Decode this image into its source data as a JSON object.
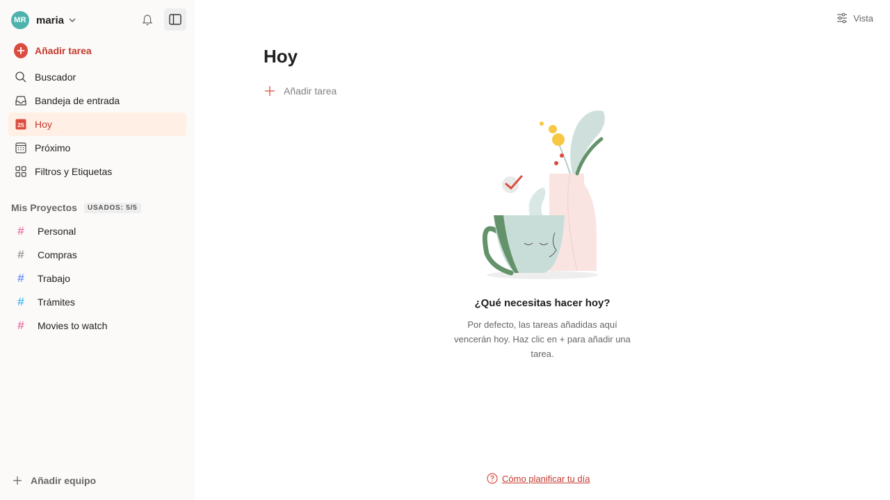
{
  "colors": {
    "accent": "#dc4c3e",
    "accent_text": "#c3392c",
    "avatar_bg": "#4eb3ac",
    "active_bg": "#ffefe5",
    "sidebar_bg": "#fcfaf8"
  },
  "user": {
    "initials": "MR",
    "name": "maria"
  },
  "sidebar": {
    "add_task_label": "Añadir tarea",
    "nav": [
      {
        "label": "Buscador",
        "icon": "search-icon"
      },
      {
        "label": "Bandeja de entrada",
        "icon": "inbox-icon"
      },
      {
        "label": "Hoy",
        "icon": "today-calendar-icon",
        "icon_text": "25",
        "active": true
      },
      {
        "label": "Próximo",
        "icon": "upcoming-calendar-icon"
      },
      {
        "label": "Filtros y Etiquetas",
        "icon": "filters-grid-icon"
      }
    ],
    "projects_title": "Mis Proyectos",
    "projects_usage": "USADOS: 5/5",
    "projects": [
      {
        "label": "Personal",
        "color": "#e05194"
      },
      {
        "label": "Compras",
        "color": "#808080"
      },
      {
        "label": "Trabajo",
        "color": "#4073ff"
      },
      {
        "label": "Trámites",
        "color": "#14aaf5"
      },
      {
        "label": "Movies to watch",
        "color": "#e05194"
      }
    ],
    "add_team_label": "Añadir equipo"
  },
  "main": {
    "view_label": "Vista",
    "title": "Hoy",
    "add_task_label": "Añadir tarea",
    "empty_title": "¿Qué necesitas hacer hoy?",
    "empty_desc": "Por defecto, las tareas añadidas aquí vencerán hoy. Haz clic en + para añadir una tarea.",
    "help_link": "Cómo planificar tu día"
  }
}
